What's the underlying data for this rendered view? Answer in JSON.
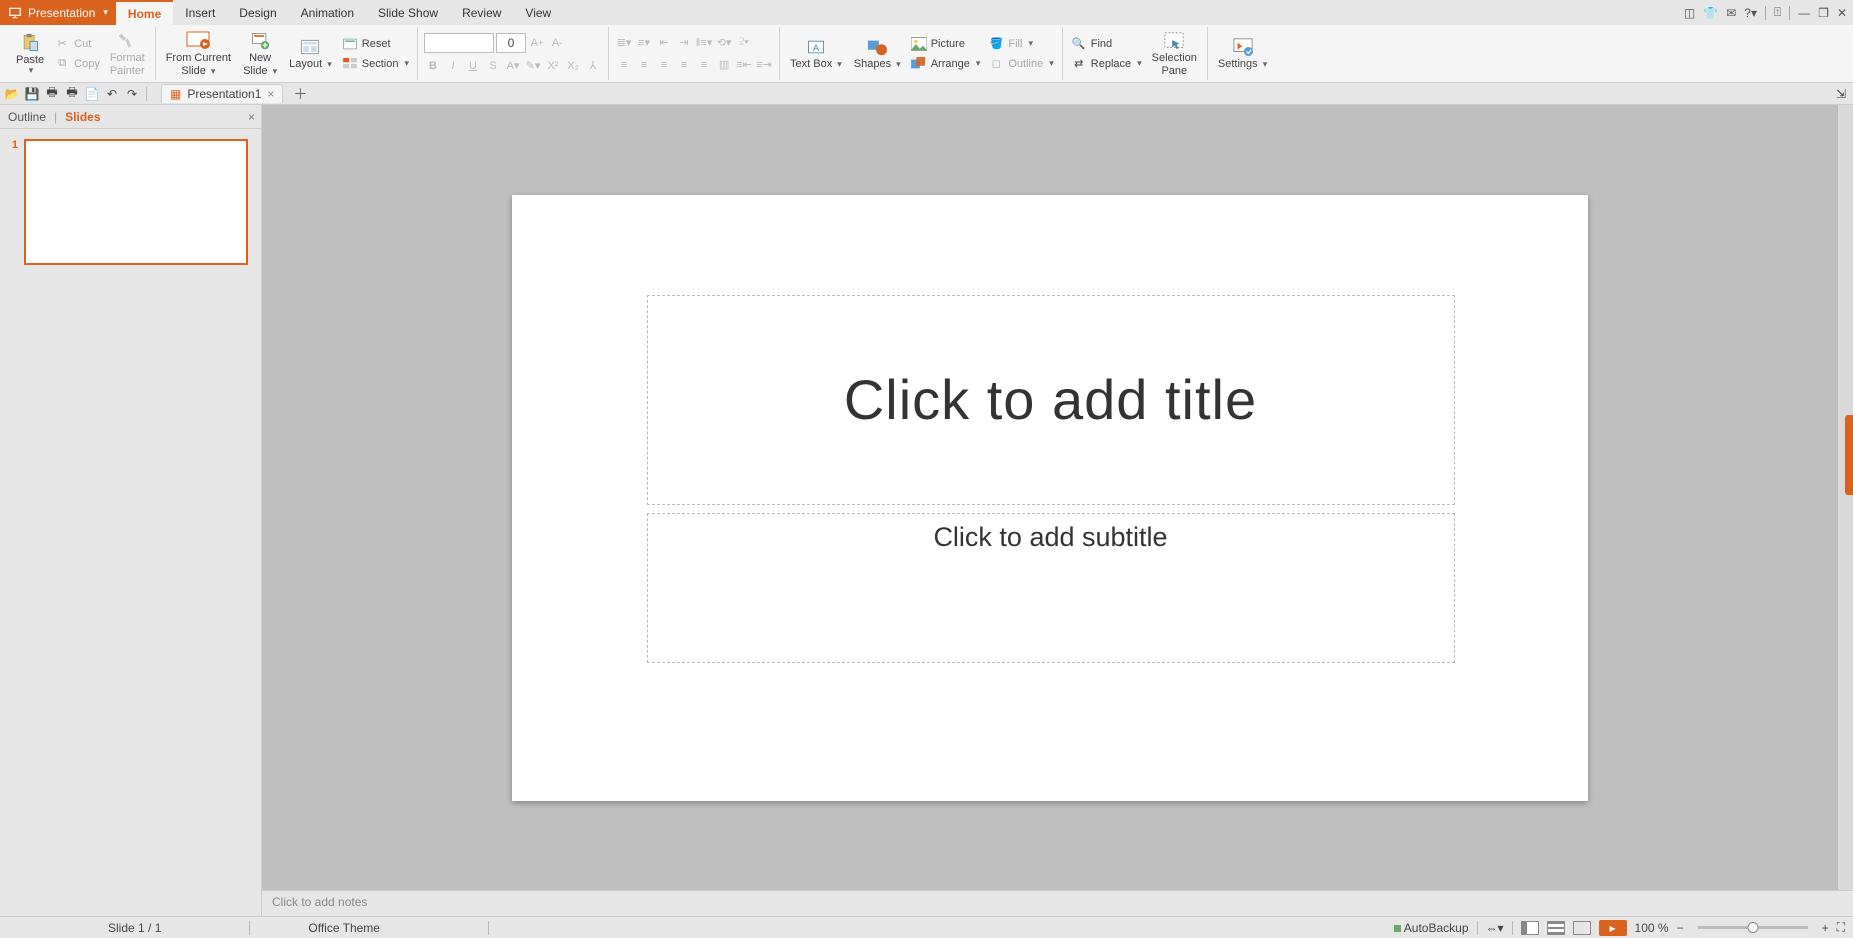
{
  "app": {
    "label": "Presentation"
  },
  "menu": {
    "tabs": [
      "Home",
      "Insert",
      "Design",
      "Animation",
      "Slide Show",
      "Review",
      "View"
    ],
    "active": "Home"
  },
  "ribbon": {
    "paste": "Paste",
    "cut": "Cut",
    "copy": "Copy",
    "format_painter_l1": "Format",
    "format_painter_l2": "Painter",
    "from_current_l1": "From Current",
    "from_current_l2": "Slide",
    "new_slide_l1": "New",
    "new_slide_l2": "Slide",
    "layout": "Layout",
    "reset": "Reset",
    "section": "Section",
    "font_name": "",
    "font_size": "0",
    "text_box": "Text Box",
    "shapes": "Shapes",
    "picture": "Picture",
    "arrange": "Arrange",
    "fill": "Fill",
    "outline": "Outline",
    "find": "Find",
    "replace": "Replace",
    "selection_l1": "Selection",
    "selection_l2": "Pane",
    "settings": "Settings"
  },
  "doc_tab": {
    "name": "Presentation1"
  },
  "side": {
    "outline": "Outline",
    "slides": "Slides",
    "thumb_num": "1"
  },
  "slide": {
    "title_ph": "Click to add title",
    "subtitle_ph": "Click to add subtitle"
  },
  "notes": {
    "placeholder": "Click to add notes"
  },
  "status": {
    "slide_pos": "Slide 1 / 1",
    "theme": "Office Theme",
    "autobackup": "AutoBackup",
    "zoom": "100 %"
  }
}
